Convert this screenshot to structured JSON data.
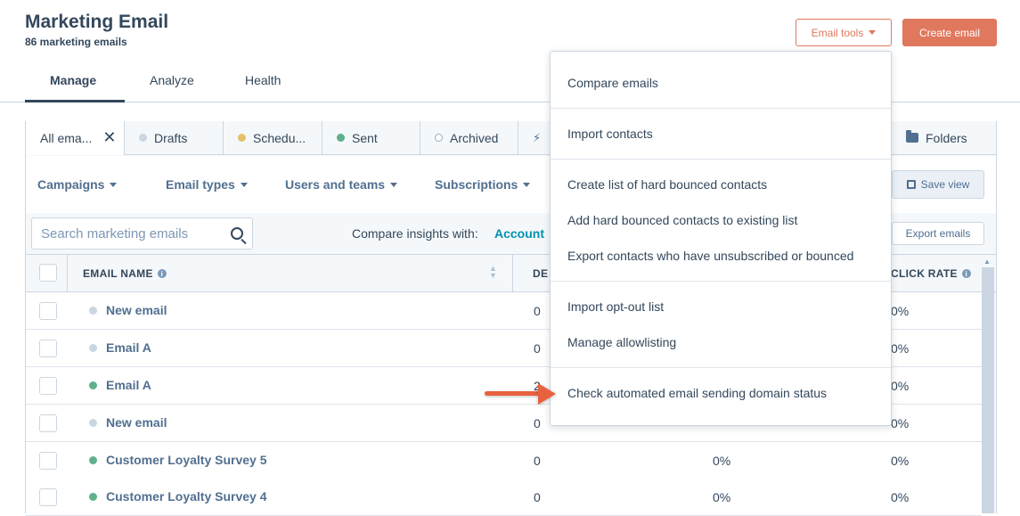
{
  "header": {
    "title": "Marketing Email",
    "subtitle": "86 marketing emails",
    "email_tools_label": "Email tools",
    "create_email_label": "Create email"
  },
  "tabs": [
    {
      "label": "Manage",
      "active": true
    },
    {
      "label": "Analyze"
    },
    {
      "label": "Health"
    }
  ],
  "view_tabs": {
    "all": "All ema...",
    "drafts": "Drafts",
    "scheduled": "Schedu...",
    "sent": "Sent",
    "archived": "Archived",
    "folders": "Folders"
  },
  "filters": {
    "campaigns": "Campaigns",
    "email_types": "Email types",
    "users_and_teams": "Users and teams",
    "subscriptions": "Subscriptions",
    "save_view": "Save view"
  },
  "search": {
    "placeholder": "Search marketing emails",
    "compare_label": "Compare insights with:",
    "compare_value": "Account",
    "export_label": "Export emails"
  },
  "table": {
    "columns": {
      "name": "EMAIL NAME",
      "delivered": "DE",
      "click_rate": "CLICK RATE"
    },
    "rows": [
      {
        "name": "New email",
        "status": "draft",
        "delivered": "0",
        "open_rate": "",
        "click_rate": "0%"
      },
      {
        "name": "Email A",
        "status": "draft",
        "delivered": "0",
        "open_rate": "",
        "click_rate": "0%"
      },
      {
        "name": "Email A",
        "status": "sent",
        "delivered": "2",
        "open_rate": "",
        "click_rate": "0%"
      },
      {
        "name": "New email",
        "status": "draft",
        "delivered": "0",
        "open_rate": "",
        "click_rate": "0%"
      },
      {
        "name": "Customer Loyalty Survey 5",
        "status": "sent",
        "delivered": "0",
        "open_rate": "0%",
        "click_rate": "0%"
      },
      {
        "name": "Customer Loyalty Survey 4",
        "status": "sent",
        "delivered": "0",
        "open_rate": "0%",
        "click_rate": "0%"
      }
    ]
  },
  "menu": {
    "compare_emails": "Compare emails",
    "import_contacts": "Import contacts",
    "create_hard_bounced": "Create list of hard bounced contacts",
    "add_hard_bounced": "Add hard bounced contacts to existing list",
    "export_unsubscribed": "Export contacts who have unsubscribed or bounced",
    "import_opt_out": "Import opt-out list",
    "manage_allowlisting": "Manage allowlisting",
    "check_domain_status": "Check automated email sending domain status"
  },
  "colors": {
    "accent": "#e0785d",
    "text": "#33475b",
    "draft_dot": "#cbd6e2",
    "sent_dot": "#5fb08b",
    "scheduled_dot": "#e5c06b",
    "arrow": "#e8613f"
  }
}
